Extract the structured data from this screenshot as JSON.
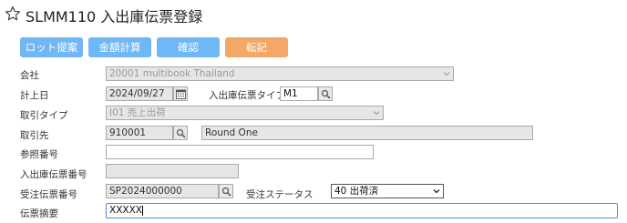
{
  "header": {
    "title": "SLMM110 入出庫伝票登録",
    "star_icon": "star-outline-icon"
  },
  "toolbar": {
    "lot_label": "ロット提案",
    "amount_label": "金額計算",
    "confirm_label": "確認",
    "post_label": "転記"
  },
  "form": {
    "company": {
      "label": "会社",
      "value": "20001 multibook Thailand"
    },
    "posting_date": {
      "label": "計上日",
      "value": "2024/09/27",
      "icon": "calendar-icon"
    },
    "slip_type": {
      "label": "入出庫伝票タイプ",
      "value": "M1",
      "icon": "search-icon"
    },
    "transaction_type": {
      "label": "取引タイプ",
      "value": "I01 売上出荷"
    },
    "partner": {
      "label": "取引先",
      "code": "910001",
      "name": "Round One",
      "icon": "search-icon"
    },
    "reference_no": {
      "label": "参照番号",
      "value": ""
    },
    "slip_no": {
      "label": "入出庫伝票番号",
      "value": ""
    },
    "order_no": {
      "label": "受注伝票番号",
      "value": "SP2024000000",
      "icon": "search-icon"
    },
    "order_status": {
      "label": "受注ステータス",
      "value": "40 出荷済"
    },
    "summary": {
      "label": "伝票摘要",
      "value": "XXXXX"
    }
  },
  "colors": {
    "button_blue": "#70b7f5",
    "button_orange": "#f3a868",
    "focus_border": "#4a8fd6"
  }
}
